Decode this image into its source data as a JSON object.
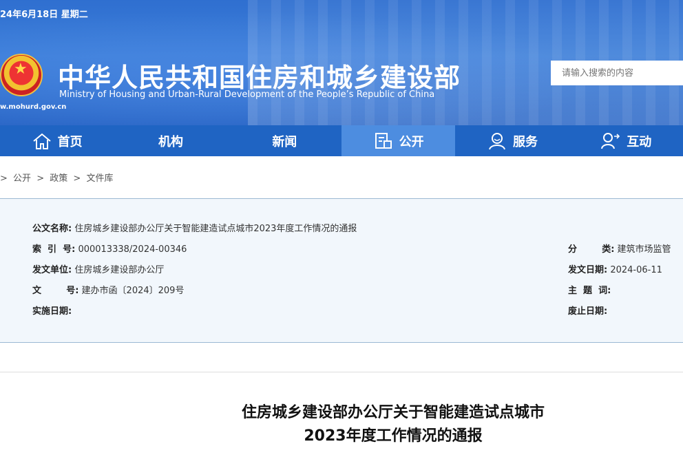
{
  "header": {
    "date": "24年6月18日 星期二",
    "title_cn": "中华人民共和国住房和城乡建设部",
    "title_en": "Ministry of Housing and Urban-Rural Development of the People’s Republic of China",
    "site_url": "w.mohurd.gov.cn",
    "search_placeholder": "请输入搜索的内容"
  },
  "nav": {
    "items": [
      {
        "label": "首页",
        "icon": "home-icon"
      },
      {
        "label": "机构",
        "icon": ""
      },
      {
        "label": "新闻",
        "icon": ""
      },
      {
        "label": "公开",
        "icon": "document-icon"
      },
      {
        "label": "服务",
        "icon": "service-icon"
      },
      {
        "label": "互动",
        "icon": "interact-icon"
      }
    ],
    "active_index": 3
  },
  "breadcrumb": {
    "sep": ">",
    "items": [
      "公开",
      "政策",
      "文件库"
    ]
  },
  "info": {
    "name_label": "公文名称:",
    "name_value": "住房城乡建设部办公厅关于智能建造试点城市2023年度工作情况的通报",
    "index_label": "索  引  号:",
    "index_value": "000013338/2024-00346",
    "unit_label": "发文单位:",
    "unit_value": "住房城乡建设部办公厅",
    "docno_label": "文        号:",
    "docno_value": "建办市函〔2024〕209号",
    "impl_label": "实施日期:",
    "impl_value": "",
    "category_label": "分        类:",
    "category_value": "建筑市场监管",
    "date_label": "发文日期:",
    "date_value": "2024-06-11",
    "subject_label": "主  题  词:",
    "subject_value": "",
    "expire_label": "废止日期:",
    "expire_value": ""
  },
  "document": {
    "title_line1": "住房城乡建设部办公厅关于智能建造试点城市",
    "title_line2": "2023年度工作情况的通报"
  },
  "colors": {
    "header_blue": "#2f6fd0",
    "nav_blue": "#1f64c3",
    "nav_active": "#4d8de0",
    "info_bg": "#f2f7fc"
  }
}
